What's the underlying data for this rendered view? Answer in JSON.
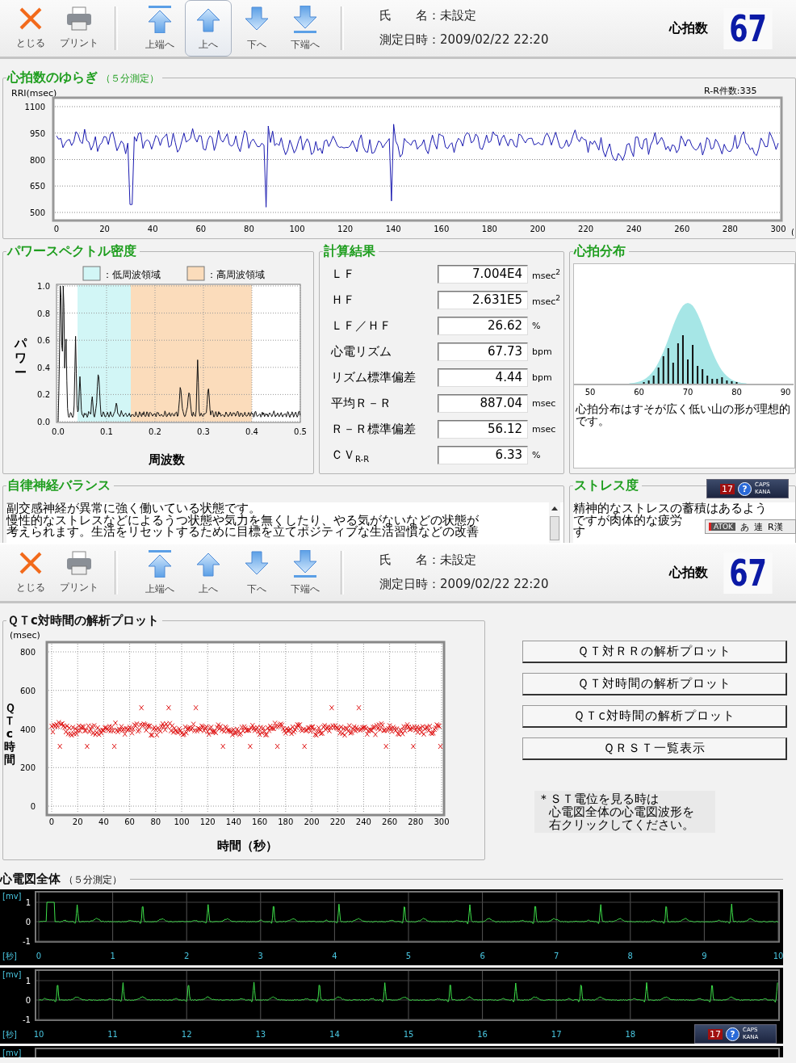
{
  "screen_1": {
    "toolbar": {
      "buttons": [
        {
          "kind": "close",
          "label": "とじる",
          "selected": false
        },
        {
          "kind": "print",
          "label": "プリント",
          "selected": false
        },
        {
          "kind": "top",
          "label": "上端へ",
          "selected": false
        },
        {
          "kind": "up",
          "label": "上へ",
          "selected": true
        },
        {
          "kind": "down",
          "label": "下へ",
          "selected": false
        },
        {
          "kind": "bottom",
          "label": "下端へ",
          "selected": false
        }
      ],
      "name_label": "氏　　名：",
      "name_value": "未設定",
      "date_label": "測定日時：",
      "date_value": "2009/02/22 22:20",
      "hr_label": "心拍数",
      "hr_value": "67"
    },
    "hrv": {
      "title": "心拍数のゆらぎ",
      "subtitle": "（５分測定）",
      "y_unit": "RRI(msec)",
      "count": "R-R件数:335",
      "yticks": [
        "1100",
        "950",
        "800",
        "650",
        "500"
      ],
      "xticks": [
        "0",
        "20",
        "40",
        "60",
        "80",
        "100",
        "120",
        "140",
        "160",
        "180",
        "200",
        "220",
        "240",
        "260",
        "280",
        "300"
      ],
      "x_unit": "("
    },
    "psd": {
      "title": "パワースペクトル密度",
      "legend": [
        {
          "label": "：低周波領域",
          "color": "#d2f6f6"
        },
        {
          "label": "：高周波領域",
          "color": "#fbdcbb"
        }
      ],
      "ylabel": "パワー",
      "xlabel": "周波数",
      "yticks": [
        "1.0",
        "0.8",
        "0.6",
        "0.4",
        "0.2",
        "0.0"
      ],
      "xticks": [
        "0.0",
        "0.1",
        "0.2",
        "0.3",
        "0.4",
        "0.5"
      ]
    },
    "results": {
      "title": "計算結果",
      "rows": [
        {
          "label": "ＬＦ",
          "value": "7.004E4",
          "unit": "msec$^{2}$"
        },
        {
          "label": "ＨＦ",
          "value": "2.631E5",
          "unit": "msec$^{2}$"
        },
        {
          "label": "ＬＦ／ＨＦ",
          "value": "26.62",
          "unit": "%"
        },
        {
          "label": "心電リズム",
          "value": "67.73",
          "unit": "bpm"
        },
        {
          "label": "リズム標準偏差",
          "value": "4.44",
          "unit": "bpm"
        },
        {
          "label": "平均Ｒ－Ｒ",
          "value": "887.04",
          "unit": "msec"
        },
        {
          "label": "Ｒ－Ｒ標準偏差",
          "value": "56.12",
          "unit": "msec"
        },
        {
          "label": "ＣＶ$_{R-R}$",
          "value": "6.33",
          "unit": "%"
        }
      ]
    },
    "distribution": {
      "title": "心拍分布",
      "xticks": [
        "50",
        "60",
        "70",
        "80",
        "90"
      ],
      "comment": "心拍分布はすそが広く低い山の形が理想的です。"
    },
    "balance": {
      "title": "自律神経バランス",
      "lines": [
        "副交感神経が異常に強く働いている状態です。",
        "慢性的なストレスなどによるうつ状態や気力を無くしたり、やる気がないなどの状態が",
        "考えられます。生活をリセットするために目標を立てポジティブな生活習慣などの改善"
      ]
    },
    "stress": {
      "title": "ストレス度",
      "lines": [
        "精神的なストレスの蓄積はあるよう",
        "ですが肉体的な疲労",
        "す"
      ]
    },
    "ime_bar": {
      "number": "17",
      "help": "?",
      "caps": "CAPS",
      "kana": "KANA"
    },
    "atok_bar": {
      "name": "ATOK",
      "modes": [
        "あ",
        "連",
        "R漢"
      ]
    }
  },
  "screen_2": {
    "toolbar": {
      "buttons": [
        {
          "kind": "close",
          "label": "とじる",
          "selected": false
        },
        {
          "kind": "print",
          "label": "プリント",
          "selected": false
        },
        {
          "kind": "top",
          "label": "上端へ",
          "selected": false
        },
        {
          "kind": "up",
          "label": "上へ",
          "selected": false
        },
        {
          "kind": "down",
          "label": "下へ",
          "selected": false
        },
        {
          "kind": "bottom",
          "label": "下端へ",
          "selected": false
        }
      ],
      "name_label": "氏　　名：",
      "name_value": "未設定",
      "date_label": "測定日時：",
      "date_value": "2009/02/22 22:20",
      "hr_label": "心拍数",
      "hr_value": "67"
    },
    "qtc": {
      "title": "ＱＴc対時間の解析プロット",
      "y_unit": "(msec)",
      "ylabel": "ＱＴc時間",
      "xlabel": "時間（秒）",
      "yticks": [
        "800",
        "600",
        "400",
        "200",
        "0"
      ],
      "xticks": [
        "0",
        "20",
        "40",
        "60",
        "80",
        "100",
        "120",
        "140",
        "160",
        "180",
        "200",
        "220",
        "240",
        "260",
        "280",
        "300"
      ]
    },
    "buttons": [
      "ＱＴ対ＲＲの解析プロット",
      "ＱＴ対時間の解析プロット",
      "ＱＴc対時間の解析プロット",
      "ＱＲＳＴ一覧表示"
    ],
    "note": [
      "＊ＳＴ電位を見る時は",
      "心電図全体の心電図波形を",
      "右クリックしてください。"
    ],
    "ecg": {
      "title": "心電図全体",
      "subtitle": "（５分測定）",
      "strips": [
        {
          "y_unit": "[mv]",
          "yticks": [
            "1",
            "0",
            "-1"
          ],
          "x_unit": "[秒]",
          "xticks": [
            "0",
            "1",
            "2",
            "3",
            "4",
            "5",
            "6",
            "7",
            "8",
            "9",
            "10"
          ]
        },
        {
          "y_unit": "[mv]",
          "yticks": [
            "1",
            "0",
            "-1"
          ],
          "x_unit": "[秒]",
          "xticks": [
            "10",
            "11",
            "12",
            "13",
            "14",
            "15",
            "16",
            "17",
            "18"
          ]
        },
        {
          "y_unit": "[mv]"
        }
      ]
    },
    "ime_bar": {
      "number": "17",
      "help": "?",
      "caps": "CAPS",
      "kana": "KANA"
    }
  }
}
